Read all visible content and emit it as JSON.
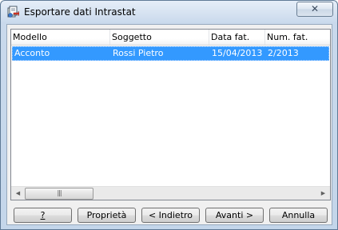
{
  "window": {
    "title": "Esportare dati Intrastat",
    "close_glyph": "✕"
  },
  "list": {
    "columns": [
      "Modello",
      "Soggetto",
      "Data fat.",
      "Num. fat."
    ],
    "rows": [
      {
        "modello": "Acconto",
        "soggetto": "Rossi Pietro",
        "data_fat": "15/04/2013",
        "num_fat": "2/2013",
        "selected": true
      }
    ]
  },
  "scrollbar": {
    "left_arrow": "◀",
    "right_arrow": "▶",
    "thumb_grip": "|||"
  },
  "buttons": {
    "help": "?",
    "properties": "Proprietà",
    "back": "< Indietro",
    "next": "Avanti >",
    "cancel": "Annulla"
  },
  "colors": {
    "selection": "#3399ff",
    "frame": "#c4d6ea"
  }
}
